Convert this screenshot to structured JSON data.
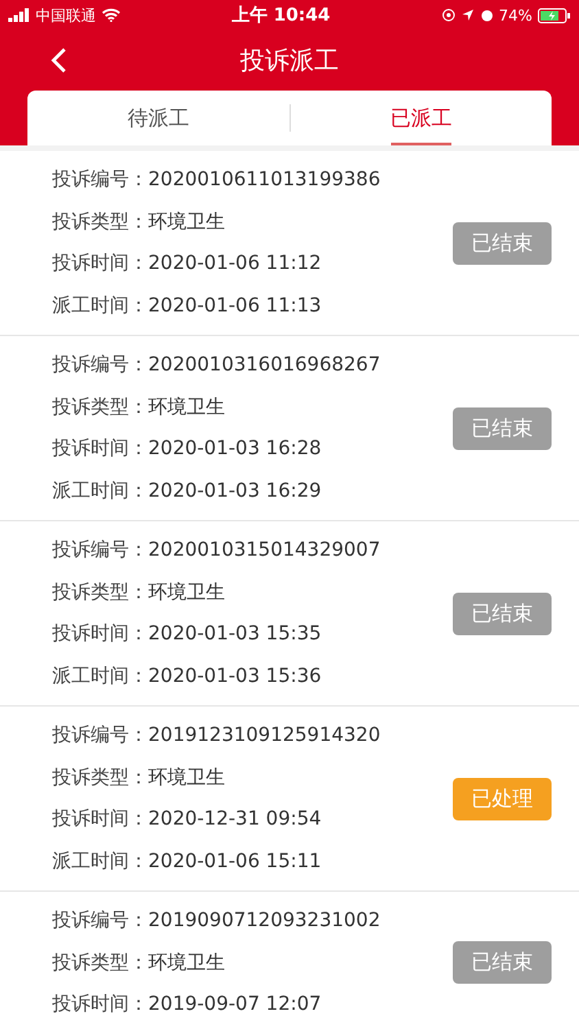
{
  "status_bar": {
    "carrier": "中国联通",
    "time": "上午 10:44",
    "battery": "74%"
  },
  "header": {
    "title": "投诉派工"
  },
  "tabs": [
    {
      "label": "待派工",
      "selected": false
    },
    {
      "label": "已派工",
      "selected": true
    }
  ],
  "records": [
    {
      "fields": [
        {
          "label": "投诉编号：",
          "value": "2020010611013199386"
        },
        {
          "label": "投诉类型：",
          "value": "环境卫生"
        },
        {
          "label": "投诉时间：",
          "value": "2020-01-06 11:12"
        },
        {
          "label": "派工时间：",
          "value": "2020-01-06 11:13"
        }
      ],
      "status": {
        "label": "已结束",
        "kind": "closed"
      }
    },
    {
      "fields": [
        {
          "label": "投诉编号：",
          "value": "2020010316016968267"
        },
        {
          "label": "投诉类型：",
          "value": "环境卫生"
        },
        {
          "label": "投诉时间：",
          "value": "2020-01-03 16:28"
        },
        {
          "label": "派工时间：",
          "value": "2020-01-03 16:29"
        }
      ],
      "status": {
        "label": "已结束",
        "kind": "closed"
      }
    },
    {
      "fields": [
        {
          "label": "投诉编号：",
          "value": "2020010315014329007"
        },
        {
          "label": "投诉类型：",
          "value": "环境卫生"
        },
        {
          "label": "投诉时间：",
          "value": "2020-01-03 15:35"
        },
        {
          "label": "派工时间：",
          "value": "2020-01-03 15:36"
        }
      ],
      "status": {
        "label": "已结束",
        "kind": "closed"
      }
    },
    {
      "fields": [
        {
          "label": "投诉编号：",
          "value": "2019123109125914320"
        },
        {
          "label": "投诉类型：",
          "value": "环境卫生"
        },
        {
          "label": "投诉时间：",
          "value": "2020-12-31 09:54"
        },
        {
          "label": "派工时间：",
          "value": "2020-01-06 15:11"
        }
      ],
      "status": {
        "label": "已处理",
        "kind": "processed"
      }
    },
    {
      "fields": [
        {
          "label": "投诉编号：",
          "value": "2019090712093231002"
        },
        {
          "label": "投诉类型：",
          "value": "环境卫生"
        },
        {
          "label": "投诉时间：",
          "value": "2019-09-07 12:07"
        }
      ],
      "status": {
        "label": "已结束",
        "kind": "closed"
      }
    }
  ]
}
